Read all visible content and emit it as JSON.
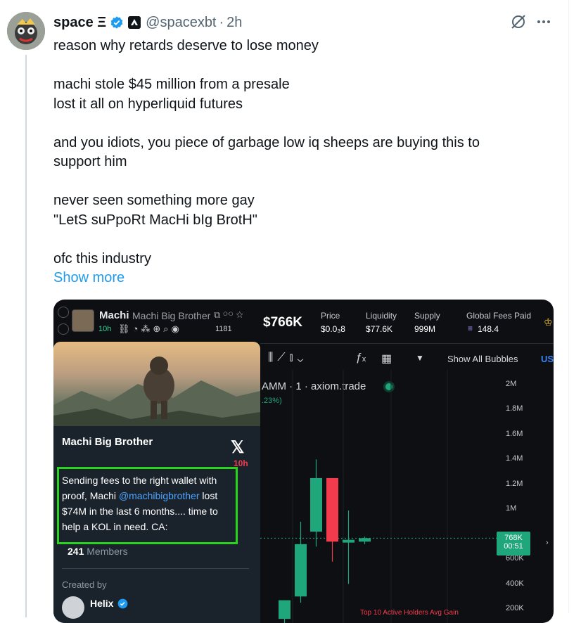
{
  "tweet": {
    "display_name": "space Ξ",
    "handle": "@spacexbt",
    "time": "2h",
    "lines": [
      "reason why retards deserve to lose money",
      "",
      "machi stole $45 million from a presale",
      "lost it all on hyperliquid futures",
      "",
      "and you idiots, you piece of garbage low iq sheeps are buying this to",
      "support him",
      "",
      "never seen something more gay",
      "\"LetS suPpoRt MacHi bIg BrotH\"",
      "",
      "ofc this industry"
    ],
    "show_more": "Show more"
  },
  "chart_header": {
    "token": "Machi",
    "token_full": "Machi Big Brother",
    "age": "10h",
    "holders": "1181",
    "market_cap": "$766K",
    "stats": [
      {
        "label": "Price",
        "value": "$0.0₃8"
      },
      {
        "label": "Liquidity",
        "value": "$77.6K"
      },
      {
        "label": "Supply",
        "value": "999M"
      },
      {
        "label": "Global Fees Paid",
        "value": "148.4"
      }
    ],
    "toolbar_bubbles": "Show All Bubbles",
    "toolbar_us": "US",
    "source": "AMM · 1 · axiom.trade",
    "pct": ".23%)",
    "bottom_hint": "Top 10 Active Holders Avg Gain"
  },
  "popup": {
    "title": "Machi Big Brother",
    "age": "10h",
    "text_before": "Sending fees to the right wallet with proof, Machi ",
    "mention": "@machibigbrother",
    "text_after": " lost $74M in the last 6 months.... time to help a KOL in need. CA:",
    "members_count": "241",
    "members_label": "Members",
    "created_by_label": "Created by",
    "creator": "Helix"
  },
  "chart_data": {
    "type": "candlestick",
    "y_ticks": [
      "2M",
      "1.8M",
      "1.6M",
      "1.4M",
      "1.2M",
      "1M",
      "800K",
      "600K",
      "400K",
      "200K"
    ],
    "price_tag": "768K",
    "price_timer": "00:51",
    "candles": [
      {
        "open": 30000,
        "close": 70000,
        "high": 70000,
        "low": 0,
        "color": "green"
      },
      {
        "open": 120000,
        "close": 270000,
        "high": 270000,
        "low": 80000,
        "color": "green"
      },
      {
        "open": 300000,
        "close": 720000,
        "high": 900000,
        "low": 250000,
        "color": "green"
      },
      {
        "open": 820000,
        "close": 1250000,
        "high": 1400000,
        "low": 700000,
        "color": "green"
      },
      {
        "open": 1250000,
        "close": 740000,
        "high": 1250000,
        "low": 580000,
        "color": "red"
      },
      {
        "open": 740000,
        "close": 755000,
        "high": 990000,
        "low": 400000,
        "color": "green"
      },
      {
        "open": 740000,
        "close": 768000,
        "high": 780000,
        "low": 720000,
        "color": "green"
      }
    ],
    "colors": {
      "green": "#1fa67a",
      "red": "#f23c4e",
      "accent": "#1d9bf0"
    }
  }
}
